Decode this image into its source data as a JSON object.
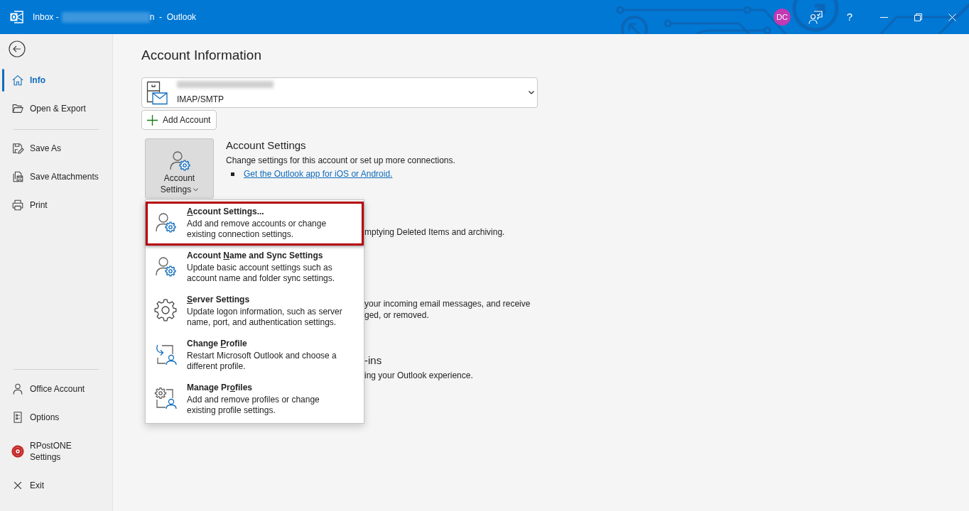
{
  "window": {
    "title_start": "Inbox -",
    "title_end": "n  -  Outlook"
  },
  "title_bar": {
    "avatar_initials": "DC",
    "help": "?"
  },
  "sidebar": {
    "upper_groups": [
      {
        "items": [
          {
            "label": "Info",
            "selected": true
          },
          {
            "label": "Open & Export",
            "selected": false
          }
        ]
      },
      {
        "items": [
          {
            "label": "Save As",
            "selected": false
          },
          {
            "label": "Save Attachments",
            "selected": false
          },
          {
            "label": "Print",
            "selected": false
          }
        ]
      }
    ],
    "lower_group": {
      "items": [
        {
          "label": "Office Account",
          "selected": false
        },
        {
          "label": "Options",
          "selected": false
        },
        {
          "label": "RPostONE Settings",
          "selected": false
        },
        {
          "label": "Exit",
          "selected": false
        }
      ]
    }
  },
  "account_information": {
    "heading": "Account Information",
    "account": {
      "type": "IMAP/SMTP"
    },
    "add_account_button": "Add Account",
    "account_settings": {
      "button_label": "Account Settings",
      "expanded": true,
      "menu_items": [
        {
          "access_key": "A",
          "title_after": "ccount Settings...",
          "description": "Add and remove accounts or change existing connection settings.",
          "highlighted": true
        },
        {
          "title_before": "Account ",
          "access_key": "N",
          "title_after": "ame and Sync Settings",
          "description": "Update basic account settings such as account name and folder sync settings.",
          "highlighted": false
        },
        {
          "access_key": "S",
          "title_after": "erver Settings",
          "description": "Update logon information, such as server name, port, and authentication settings.",
          "highlighted": false
        },
        {
          "title_before": "Change ",
          "access_key": "P",
          "title_after": "rofile",
          "description": "Restart Microsoft Outlook and choose a different profile.",
          "highlighted": false
        },
        {
          "title_before": "Manage Pr",
          "access_key": "o",
          "title_after": "files",
          "description": "Add and remove profiles or change existing profile settings.",
          "highlighted": false
        }
      ],
      "heading": "Account Settings",
      "description": "Change settings for this account or set up more connections.",
      "link": "Get the Outlook app for iOS or Android."
    },
    "partly_hidden_sections": [
      {
        "lines": [
          "mptying Deleted Items and archiving."
        ]
      },
      {
        "lines": [
          "your incoming email messages, and receive",
          "ged, or removed."
        ]
      },
      {
        "heading": "-ins",
        "lines": [
          "ing your Outlook experience."
        ]
      }
    ]
  }
}
